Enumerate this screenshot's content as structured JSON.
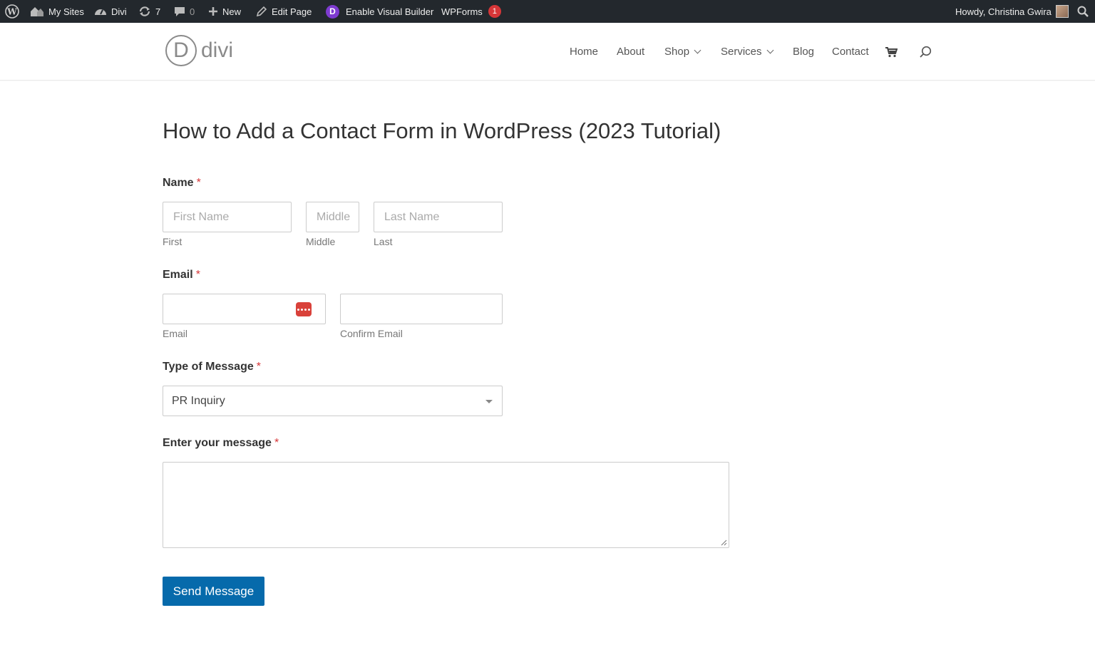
{
  "adminbar": {
    "my_sites": "My Sites",
    "site_name": "Divi",
    "updates_count": "7",
    "comments_count": "0",
    "new_label": "New",
    "edit_page": "Edit Page",
    "visual_builder": "Enable Visual Builder",
    "divi_letter": "D",
    "wpforms": "WPForms",
    "wpforms_badge": "1",
    "howdy": "Howdy, Christina Gwira"
  },
  "header": {
    "logo_letter": "D",
    "logo_word": "divi",
    "nav": {
      "home": "Home",
      "about": "About",
      "shop": "Shop",
      "services": "Services",
      "blog": "Blog",
      "contact": "Contact"
    }
  },
  "page": {
    "title": "How to Add a Contact Form in WordPress (2023 Tutorial)"
  },
  "form": {
    "required_mark": "*",
    "name": {
      "label": "Name",
      "first_placeholder": "First Name",
      "middle_placeholder": "Middle",
      "last_placeholder": "Last Name",
      "first_sublabel": "First",
      "middle_sublabel": "Middle",
      "last_sublabel": "Last"
    },
    "email": {
      "label": "Email",
      "email_sublabel": "Email",
      "confirm_sublabel": "Confirm Email"
    },
    "message_type": {
      "label": "Type of Message",
      "selected": "PR Inquiry"
    },
    "message": {
      "label": "Enter your message"
    },
    "submit_label": "Send Message"
  },
  "colors": {
    "adminbar_bg": "#23282d",
    "button_bg": "#066aab",
    "required": "#d63638",
    "badge": "#d63638",
    "divi_purple": "#7e3bd0"
  }
}
